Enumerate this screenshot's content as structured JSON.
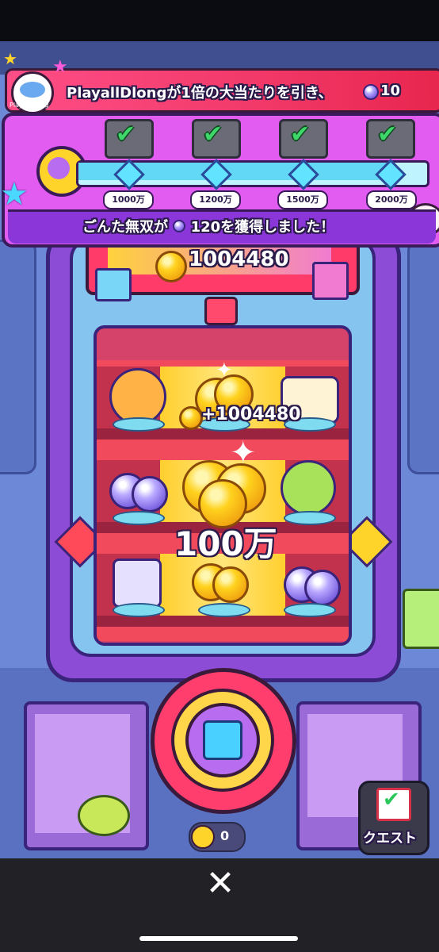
{
  "banner": {
    "player_name": "PlayallDlong",
    "message": "PlayallDlongが1倍の大当たりを引き、",
    "gem_amount": "10"
  },
  "quest_progress": {
    "milestones": [
      "1000万",
      "1200万",
      "1500万",
      "2000万"
    ],
    "result_message": "ごんた無双が",
    "result_gem_amount": "120",
    "result_suffix": "を獲得しました！"
  },
  "machine": {
    "score": "1004480",
    "gain": "+1004480",
    "big_win": "100万"
  },
  "bottom": {
    "counter_value": "0",
    "quest_button_label": "クエスト"
  },
  "close_symbol": "✕",
  "colors": {
    "banner": "#f23a6a",
    "quest_panel": "#e35cf2",
    "machine": "#8c4cd6",
    "button": "#ff3e6e",
    "gold": "#ffd21e"
  }
}
